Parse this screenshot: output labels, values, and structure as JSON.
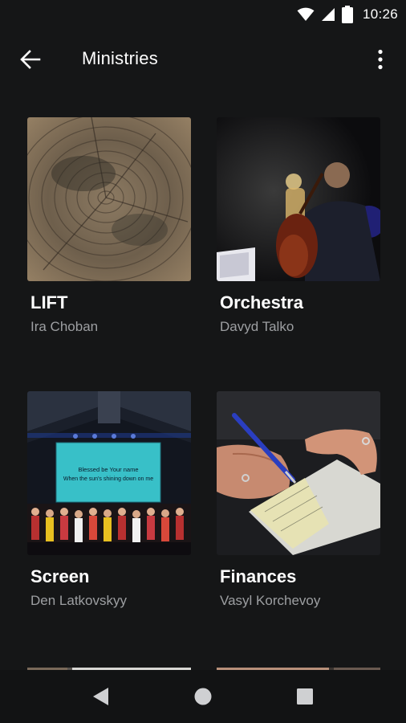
{
  "status_bar": {
    "time": "10:26",
    "icons": [
      "wifi-icon",
      "cell-signal-icon",
      "battery-icon"
    ]
  },
  "app_bar": {
    "title": "Ministries",
    "back_icon": "arrow-left-icon",
    "menu_icon": "more-vert-icon"
  },
  "ministries": [
    {
      "title": "LIFT",
      "leader": "Ira Choban",
      "image": "wood-rings-photo"
    },
    {
      "title": "Orchestra",
      "leader": "Davyd Talko",
      "image": "cellist-photo"
    },
    {
      "title": "Screen",
      "leader": "Den Latkovskyy",
      "image": "choir-stage-photo"
    },
    {
      "title": "Finances",
      "leader": "Vasyl Korchevoy",
      "image": "writing-check-photo"
    }
  ],
  "projection_text": {
    "line1": "Blessed be Your name",
    "line2": "When the sun's shining down on me"
  },
  "nav_bar": {
    "icons": [
      "back-triangle-icon",
      "home-circle-icon",
      "recents-square-icon"
    ]
  },
  "colors": {
    "background": "#151617",
    "text_primary": "#ffffff",
    "text_secondary": "#9d9fa2"
  }
}
